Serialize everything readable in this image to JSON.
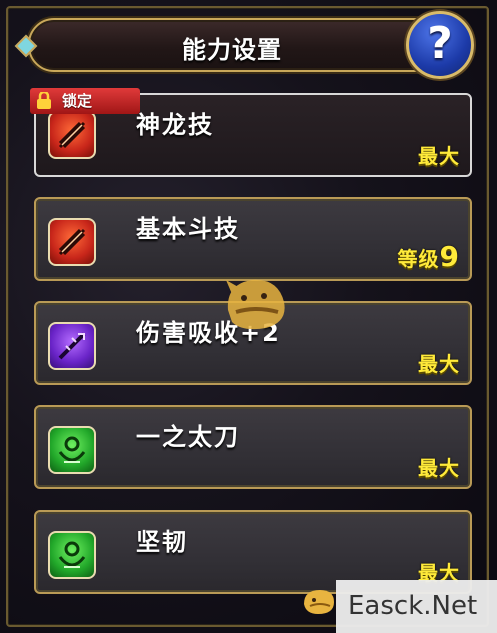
{
  "title": "能力设置",
  "help_label": "?",
  "lock_label": "锁定",
  "skills": [
    {
      "name": "神龙技",
      "level": "最大",
      "icon": "red-slash-icon",
      "locked": true
    },
    {
      "name": "基本斗技",
      "level_prefix": "等级",
      "level_num": "9",
      "icon": "red-slash-icon"
    },
    {
      "name": "伤害吸收+2",
      "level": "最大",
      "icon": "purple-burst-icon"
    },
    {
      "name": "一之太刀",
      "level": "最大",
      "icon": "green-figure-icon"
    },
    {
      "name": "坚韧",
      "level": "最大",
      "icon": "green-figure-icon"
    }
  ],
  "watermark": "Easck.Net",
  "colors": {
    "level_text": "#ffea3a",
    "card_border": "#b99a56",
    "lock_badge": "#d02828"
  }
}
